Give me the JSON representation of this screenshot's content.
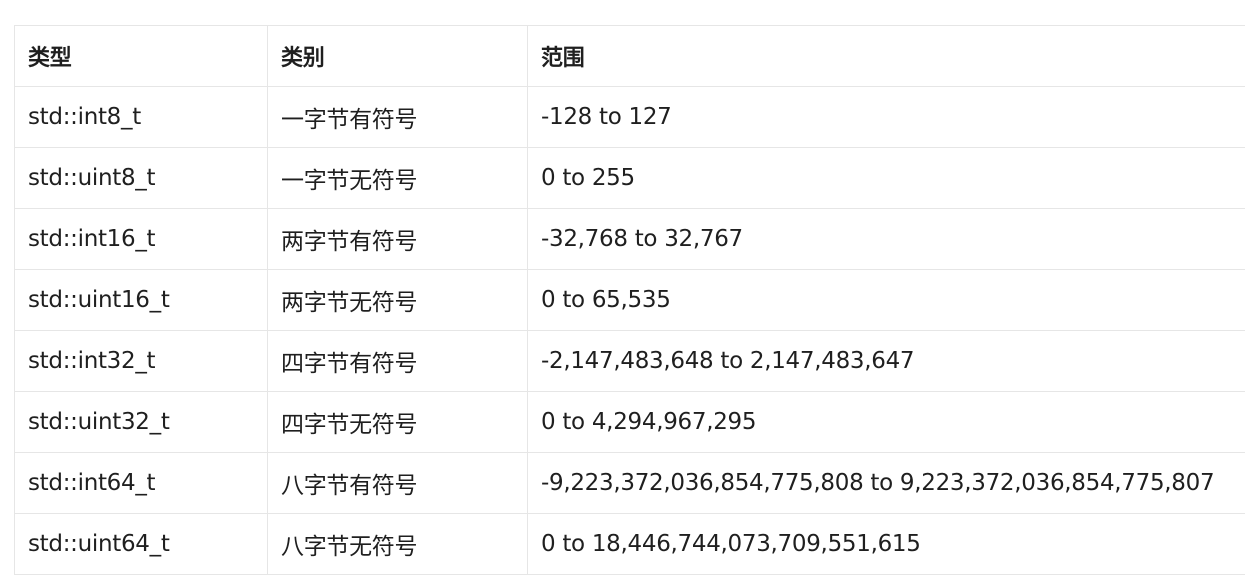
{
  "table": {
    "headers": [
      "类型",
      "类别",
      "范围"
    ],
    "rows": [
      [
        "std::int8_t",
        "一字节有符号",
        "-128 to 127"
      ],
      [
        "std::uint8_t",
        "一字节无符号",
        "0 to 255"
      ],
      [
        "std::int16_t",
        "两字节有符号",
        "-32,768 to 32,767"
      ],
      [
        "std::uint16_t",
        "两字节无符号",
        "0 to 65,535"
      ],
      [
        "std::int32_t",
        "四字节有符号",
        "-2,147,483,648 to 2,147,483,647"
      ],
      [
        "std::uint32_t",
        "四字节无符号",
        "0 to 4,294,967,295"
      ],
      [
        "std::int64_t",
        "八字节有符号",
        "-9,223,372,036,854,775,808 to 9,223,372,036,854,775,807"
      ],
      [
        "std::uint64_t",
        "八字节无符号",
        "0 to 18,446,744,073,709,551,615"
      ]
    ]
  }
}
